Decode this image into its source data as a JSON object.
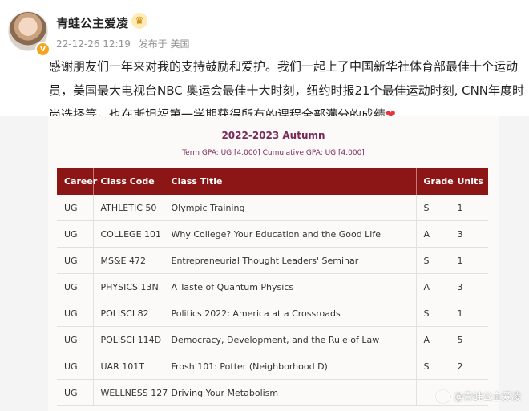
{
  "post": {
    "username": "青蛙公主爱凌",
    "timestamp": "22-12-26 12:19",
    "source": "发布于 美国",
    "text": "感谢朋友们一年来对我的支持鼓励和爱护。我们一起上了中国新华社体育部最佳十个运动员，美国最大电视台NBC 奥运会最佳十大时刻，纽约时报21个最佳运动时刻, CNN年度时尚选择等。也在斯坦福第一学期获得所有的课程全部满分的成绩",
    "heart": "❤",
    "verified_badge": "V",
    "crown_icon": "crown-icon"
  },
  "transcript": {
    "term_title": "2022-2023 Autumn",
    "gpa_line": "Term GPA: UG [4.000]  Cumulative GPA: UG [4.000]",
    "headers": [
      "Career",
      "Class Code",
      "Class Title",
      "Grade",
      "Units"
    ],
    "rows": [
      [
        "UG",
        "ATHLETIC 50",
        "Olympic Training",
        "S",
        "1"
      ],
      [
        "UG",
        "COLLEGE 101",
        "Why College? Your Education and the Good Life",
        "A",
        "3"
      ],
      [
        "UG",
        "MS&E 472",
        "Entrepreneurial Thought Leaders' Seminar",
        "S",
        "1"
      ],
      [
        "UG",
        "PHYSICS 13N",
        "A Taste of Quantum Physics",
        "A",
        "3"
      ],
      [
        "UG",
        "POLISCI 82",
        "Politics 2022: America at a Crossroads",
        "S",
        "1"
      ],
      [
        "UG",
        "POLISCI 114D",
        "Democracy, Development, and the Rule of Law",
        "A",
        "5"
      ],
      [
        "UG",
        "UAR 101T",
        "Frosh 101: Potter (Neighborhood D)",
        "S",
        "2"
      ],
      [
        "UG",
        "WELLNESS 127",
        "Driving Your Metabolism",
        "",
        ""
      ]
    ],
    "header_color": "#8c1515"
  },
  "watermark": "@青蛙公主爱凌"
}
